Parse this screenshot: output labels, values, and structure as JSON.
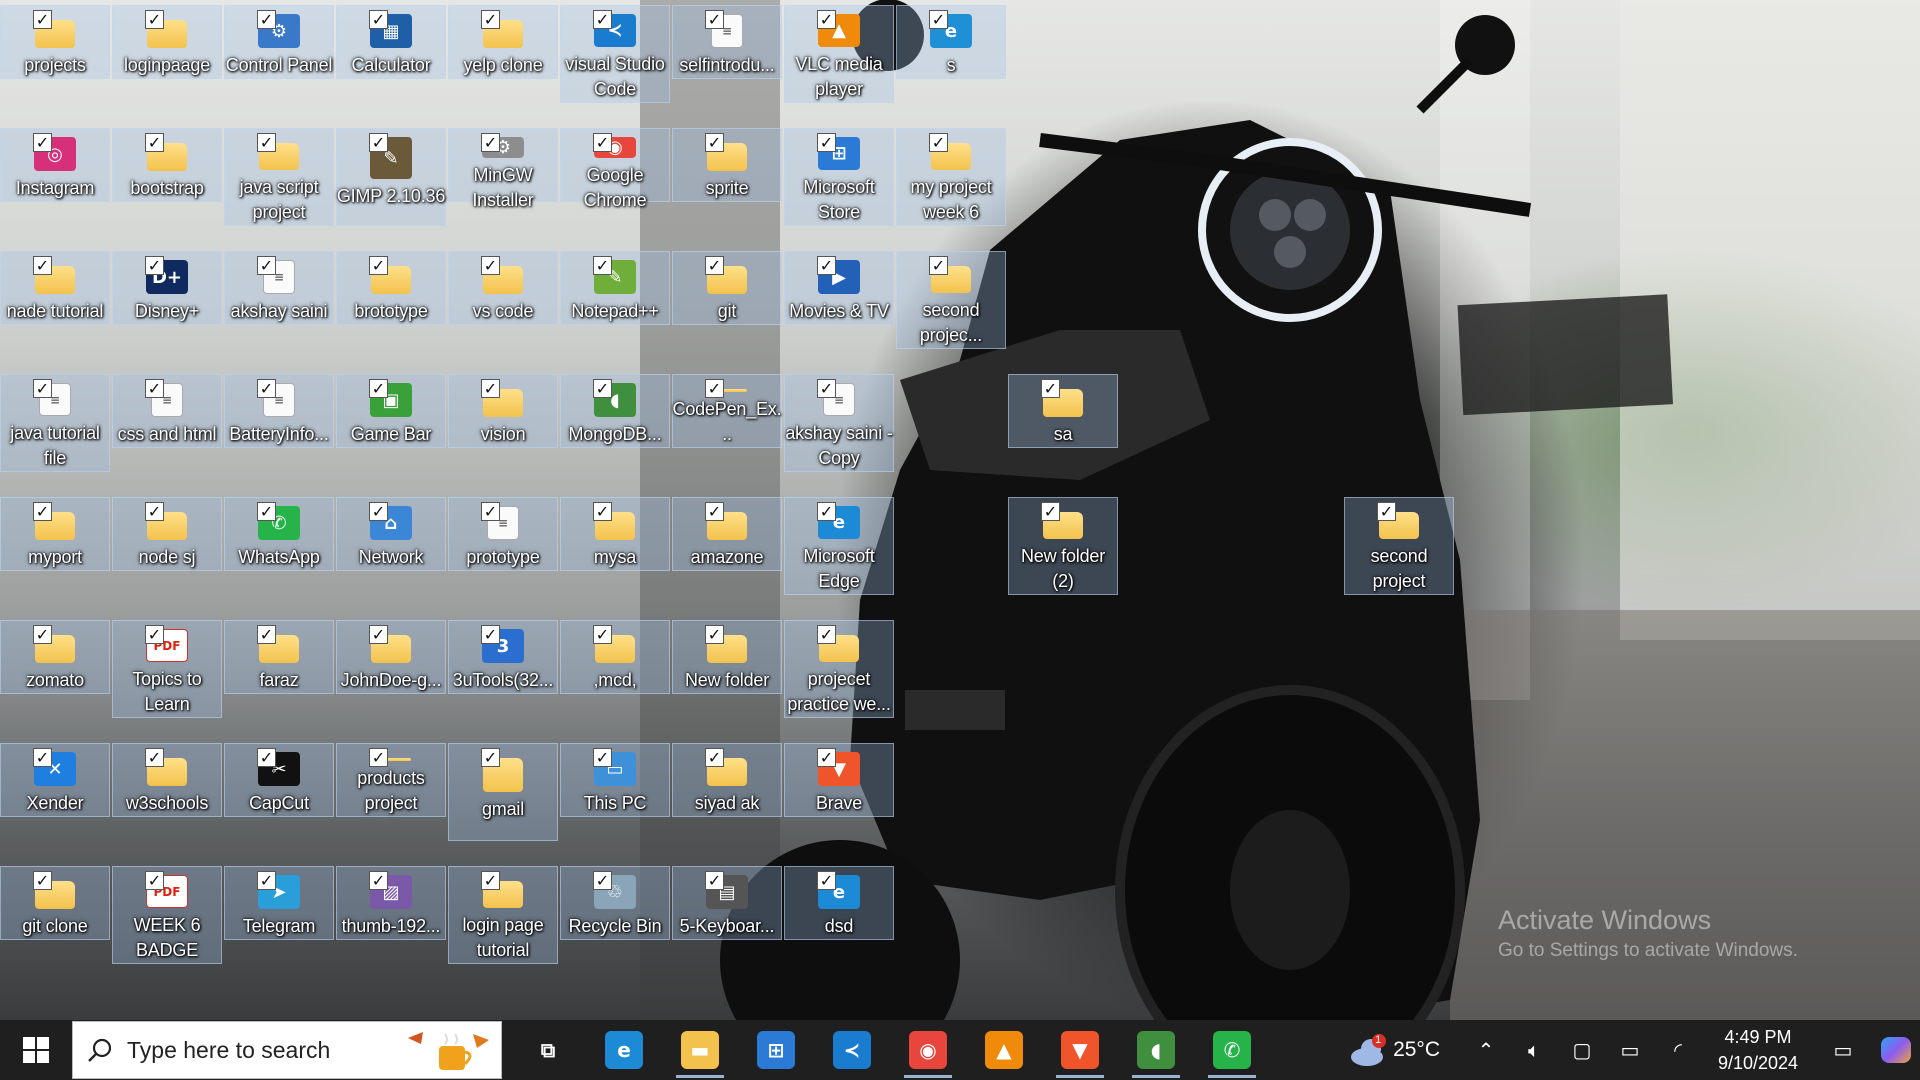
{
  "desktop": {
    "icons": [
      {
        "label": "projects",
        "type": "folder",
        "sel": true
      },
      {
        "label": "loginpaage",
        "type": "folder",
        "sel": true
      },
      {
        "label": "Control Panel",
        "type": "app",
        "glyph": "⚙",
        "color": "#3a78c9",
        "sel": true
      },
      {
        "label": "Calculator",
        "type": "app",
        "glyph": "▦",
        "color": "#1f5fa8",
        "sel": true
      },
      {
        "label": "yelp clone",
        "type": "folder",
        "sel": true
      },
      {
        "label": "visual Studio Code",
        "type": "app",
        "glyph": "≺",
        "color": "#1a7ccf",
        "sel": true
      },
      {
        "label": "selfintrodu...",
        "type": "file",
        "sel": true
      },
      {
        "label": "VLC media player",
        "type": "app",
        "glyph": "▲",
        "color": "#f08a0a",
        "sel": true
      },
      {
        "label": "s",
        "type": "app",
        "glyph": "e",
        "color": "#1f8fd6",
        "sel": true
      },
      {
        "label": "Instagram",
        "type": "app",
        "glyph": "◎",
        "color": "#d6307a",
        "sel": true
      },
      {
        "label": "bootstrap",
        "type": "folder",
        "sel": true
      },
      {
        "label": "java script project",
        "type": "folder",
        "sel": true
      },
      {
        "label": "GIMP 2.10.36",
        "type": "app",
        "glyph": "✎",
        "color": "#6b5a3a",
        "sel": true
      },
      {
        "label": "MinGW Installer",
        "type": "app",
        "glyph": "⚙",
        "color": "#8d8d8d",
        "sel": true
      },
      {
        "label": "Google Chrome",
        "type": "app",
        "glyph": "◉",
        "color": "#e8453c",
        "sel": true
      },
      {
        "label": "sprite",
        "type": "folder",
        "sel": true
      },
      {
        "label": "Microsoft Store",
        "type": "app",
        "glyph": "⊞",
        "color": "#2b7bd6",
        "sel": true
      },
      {
        "label": "my project week 6",
        "type": "folder",
        "sel": true
      },
      {
        "label": "nade tutorial",
        "type": "folder",
        "sel": true
      },
      {
        "label": "Disney+",
        "type": "app",
        "glyph": "D+",
        "color": "#0f2a5e",
        "sel": true
      },
      {
        "label": "akshay saini",
        "type": "file",
        "sel": true
      },
      {
        "label": "brototype",
        "type": "folder",
        "sel": true
      },
      {
        "label": "vs code",
        "type": "folder",
        "sel": true
      },
      {
        "label": "Notepad++",
        "type": "app",
        "glyph": "✎",
        "color": "#6fae3a",
        "sel": true
      },
      {
        "label": "git",
        "type": "folder",
        "sel": true
      },
      {
        "label": "Movies & TV",
        "type": "app",
        "glyph": "▶",
        "color": "#2360b8",
        "sel": true
      },
      {
        "label": "second projec...",
        "type": "folder",
        "sel": true
      },
      {
        "label": "java tutorial file",
        "type": "file",
        "sel": true
      },
      {
        "label": "css and html",
        "type": "file",
        "sel": true
      },
      {
        "label": "BatteryInfo...",
        "type": "file",
        "sel": true
      },
      {
        "label": "Game Bar",
        "type": "app",
        "glyph": "▣",
        "color": "#3aa03a",
        "sel": true
      },
      {
        "label": "vision",
        "type": "folder",
        "sel": true
      },
      {
        "label": "MongoDB...",
        "type": "app",
        "glyph": "◖",
        "color": "#3f8f3f",
        "sel": true
      },
      {
        "label": "CodePen_Ex...",
        "type": "folder",
        "sel": true
      },
      {
        "label": "akshay saini - Copy",
        "type": "file",
        "sel": true
      },
      {
        "label": "sa",
        "type": "folder",
        "sel": true
      },
      {
        "label": "myport",
        "type": "folder",
        "sel": true
      },
      {
        "label": "node sj",
        "type": "folder",
        "sel": true
      },
      {
        "label": "WhatsApp",
        "type": "app",
        "glyph": "✆",
        "color": "#25b34a",
        "sel": true
      },
      {
        "label": "Network",
        "type": "app",
        "glyph": "⌂",
        "color": "#3b86d6",
        "sel": true
      },
      {
        "label": "prototype",
        "type": "file",
        "sel": true
      },
      {
        "label": "mysa",
        "type": "folder",
        "sel": true
      },
      {
        "label": "amazone",
        "type": "folder",
        "sel": true
      },
      {
        "label": "Microsoft Edge",
        "type": "app",
        "glyph": "e",
        "color": "#1d8ad6",
        "sel": true
      },
      {
        "label": "New folder (2)",
        "type": "folder",
        "sel": true
      },
      {
        "label": "second project",
        "type": "folder",
        "sel": true
      },
      {
        "label": "zomato",
        "type": "folder",
        "sel": true
      },
      {
        "label": "Topics to Learn",
        "type": "pdf",
        "sel": true
      },
      {
        "label": "faraz",
        "type": "folder",
        "sel": true
      },
      {
        "label": "JohnDoe-g...",
        "type": "folder",
        "sel": true
      },
      {
        "label": "3uTools(32...",
        "type": "app",
        "glyph": "3",
        "color": "#2a6fd0",
        "sel": true
      },
      {
        "label": ",mcd,",
        "type": "folder",
        "sel": true
      },
      {
        "label": "New folder",
        "type": "folder",
        "sel": true
      },
      {
        "label": "projecet practice we...",
        "type": "folder",
        "sel": true
      },
      {
        "label": "Xender",
        "type": "app",
        "glyph": "✕",
        "color": "#1f7fe0",
        "sel": true
      },
      {
        "label": "w3schools",
        "type": "folder",
        "sel": true
      },
      {
        "label": "CapCut",
        "type": "app",
        "glyph": "✂",
        "color": "#111111",
        "sel": true
      },
      {
        "label": "products project",
        "type": "folder",
        "sel": true
      },
      {
        "label": "gmail",
        "type": "folder",
        "sel": true
      },
      {
        "label": "This PC",
        "type": "app",
        "glyph": "▭",
        "color": "#3e91d8",
        "sel": true
      },
      {
        "label": "siyad ak",
        "type": "folder",
        "sel": true
      },
      {
        "label": "Brave",
        "type": "app",
        "glyph": "▼",
        "color": "#f0542a",
        "sel": true
      },
      {
        "label": "git clone",
        "type": "folder",
        "sel": true
      },
      {
        "label": "WEEK 6 BADGE",
        "type": "pdf",
        "sel": true
      },
      {
        "label": "Telegram",
        "type": "app",
        "glyph": "➤",
        "color": "#2a9ed8",
        "sel": true
      },
      {
        "label": "thumb-192...",
        "type": "app",
        "glyph": "▨",
        "color": "#7a5aa8",
        "sel": true
      },
      {
        "label": "login page tutorial",
        "type": "folder",
        "sel": true
      },
      {
        "label": "Recycle Bin",
        "type": "app",
        "glyph": "♲",
        "color": "#8aa4b8",
        "sel": true
      },
      {
        "label": "5-Keyboar...",
        "type": "app",
        "glyph": "▤",
        "color": "#555555",
        "sel": true
      },
      {
        "label": "dsd",
        "type": "app",
        "glyph": "e",
        "color": "#1d8ad6",
        "sel": true
      }
    ],
    "watermark": {
      "line1": "Activate Windows",
      "line2": "Go to Settings to activate Windows."
    }
  },
  "taskbar": {
    "search_placeholder": "Type here to search",
    "apps": [
      {
        "name": "task-view",
        "glyph": "⧉",
        "color": "transparent",
        "open": false
      },
      {
        "name": "edge",
        "glyph": "e",
        "color": "#1d8ad6",
        "open": false
      },
      {
        "name": "file-explorer",
        "glyph": "▬",
        "color": "#f2c24c",
        "open": true
      },
      {
        "name": "microsoft-store",
        "glyph": "⊞",
        "color": "#2b7bd6",
        "open": false
      },
      {
        "name": "vscode",
        "glyph": "≺",
        "color": "#1a7ccf",
        "open": false
      },
      {
        "name": "chrome",
        "glyph": "◉",
        "color": "#e8453c",
        "open": true
      },
      {
        "name": "vlc",
        "glyph": "▲",
        "color": "#f08a0a",
        "open": false
      },
      {
        "name": "brave",
        "glyph": "▼",
        "color": "#f0542a",
        "open": true
      },
      {
        "name": "mongodb-compass",
        "glyph": "◖",
        "color": "#3f8f3f",
        "open": true
      },
      {
        "name": "whatsapp",
        "glyph": "✆",
        "color": "#25b34a",
        "open": true
      }
    ],
    "weather": {
      "temp": "25°C",
      "badge": "1"
    },
    "clock": {
      "time": "4:49 PM",
      "date": "9/10/2024"
    }
  }
}
